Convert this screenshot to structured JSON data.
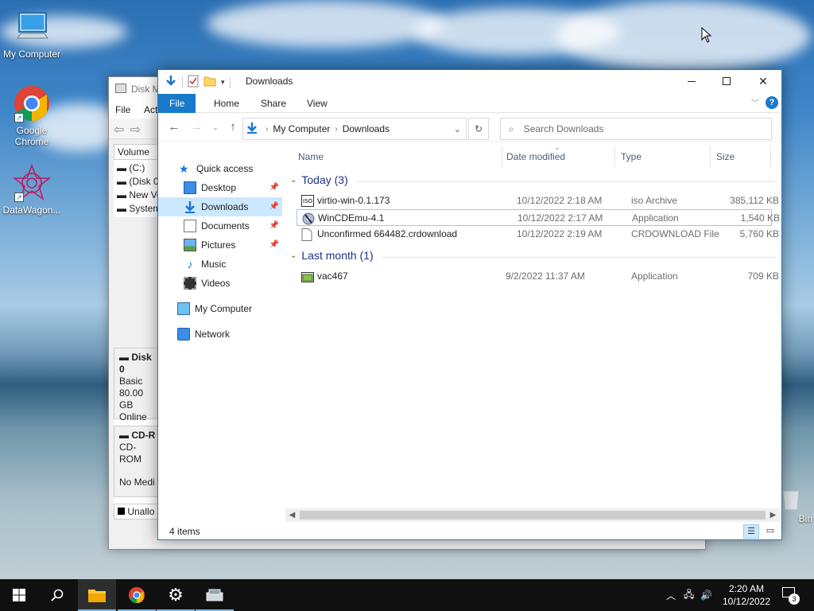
{
  "desktop": {
    "icons": [
      {
        "label": "My Computer"
      },
      {
        "label": "Google Chrome"
      },
      {
        "label": "DataWagon..."
      },
      {
        "label": "Bin"
      }
    ]
  },
  "bg_window": {
    "title": "Disk M",
    "menu": [
      "File",
      "Act"
    ],
    "volume_header": "Volume",
    "volumes": [
      "(C:)",
      "(Disk 0",
      "New Vo",
      "System"
    ],
    "disk0": {
      "name": "Disk 0",
      "type": "Basic",
      "size": "80.00 GB",
      "status": "Online"
    },
    "cdrom": {
      "name": "CD-R",
      "type": "CD-ROM",
      "status": "No Medi"
    },
    "legend": "Unallo"
  },
  "explorer": {
    "title": "Downloads",
    "tabs": {
      "file": "File",
      "home": "Home",
      "share": "Share",
      "view": "View"
    },
    "address": {
      "root": "My Computer",
      "current": "Downloads"
    },
    "search_placeholder": "Search Downloads",
    "nav": {
      "quick_access": "Quick access",
      "desktop": "Desktop",
      "downloads": "Downloads",
      "documents": "Documents",
      "pictures": "Pictures",
      "music": "Music",
      "videos": "Videos",
      "my_computer": "My Computer",
      "network": "Network"
    },
    "columns": {
      "name": "Name",
      "date": "Date modified",
      "type": "Type",
      "size": "Size"
    },
    "groups": [
      {
        "label": "Today (3)"
      },
      {
        "label": "Last month (1)"
      }
    ],
    "files": [
      {
        "name": "virtio-win-0.1.173",
        "date": "10/12/2022 2:18 AM",
        "type": "iso Archive",
        "size": "385,112 KB"
      },
      {
        "name": "WinCDEmu-4.1",
        "date": "10/12/2022 2:17 AM",
        "type": "Application",
        "size": "1,540 KB"
      },
      {
        "name": "Unconfirmed 664482.crdownload",
        "date": "10/12/2022 2:19 AM",
        "type": "CRDOWNLOAD File",
        "size": "5,760 KB"
      },
      {
        "name": "vac467",
        "date": "9/2/2022 11:37 AM",
        "type": "Application",
        "size": "709 KB"
      }
    ],
    "status": "4 items"
  },
  "taskbar": {
    "time": "2:20 AM",
    "date": "10/12/2022",
    "notifications": "3"
  },
  "colors": {
    "accent": "#1979ca",
    "selection": "#cce8ff",
    "taskbar": "#101010"
  }
}
